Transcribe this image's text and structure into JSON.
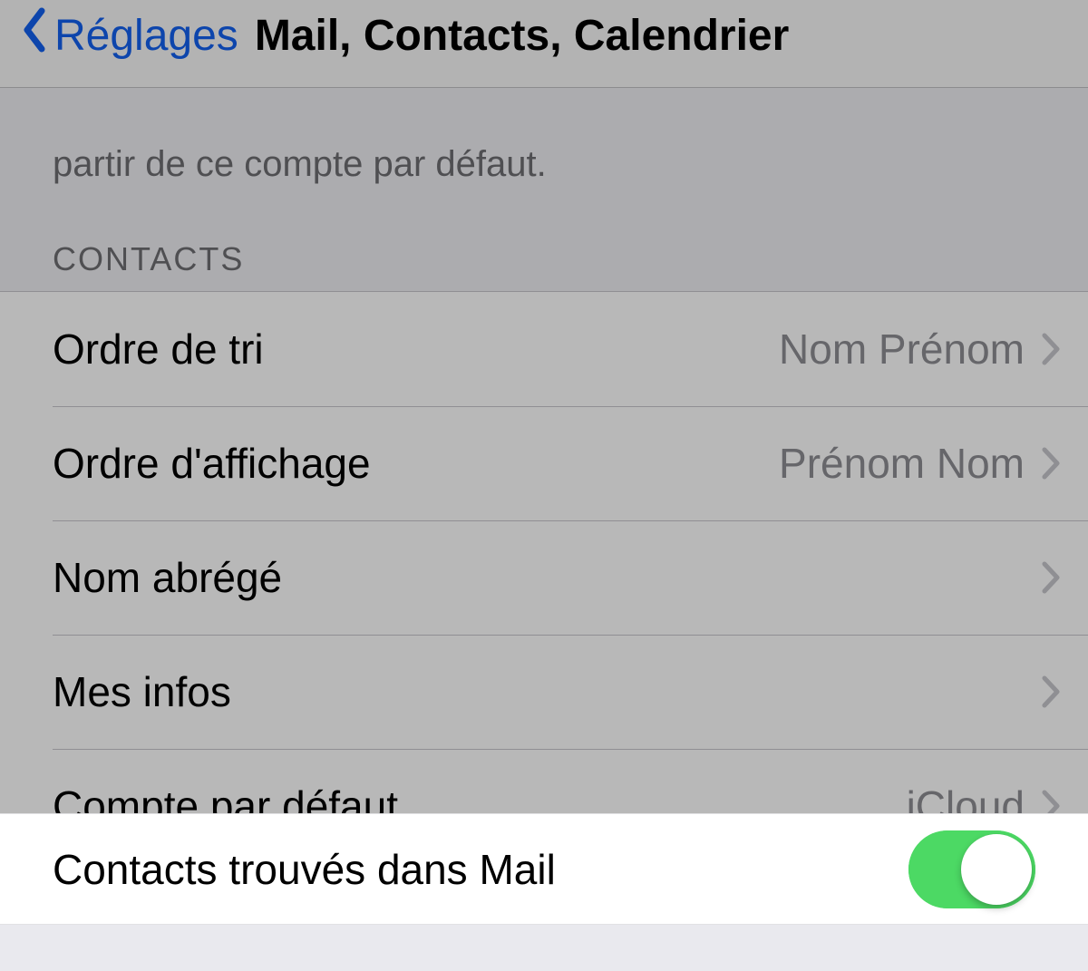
{
  "nav": {
    "back_label": "Réglages",
    "title": "Mail, Contacts, Calendrier"
  },
  "clipped_footer": "partir de ce compte par défaut.",
  "section_header": "CONTACTS",
  "rows": [
    {
      "label": "Ordre de tri",
      "value": "Nom Prénom"
    },
    {
      "label": "Ordre d'affichage",
      "value": "Prénom Nom"
    },
    {
      "label": "Nom abrégé",
      "value": ""
    },
    {
      "label": "Mes infos",
      "value": ""
    },
    {
      "label": "Compte par défaut",
      "value": "iCloud"
    }
  ],
  "highlight": {
    "label": "Contacts trouvés dans Mail",
    "on": true
  }
}
